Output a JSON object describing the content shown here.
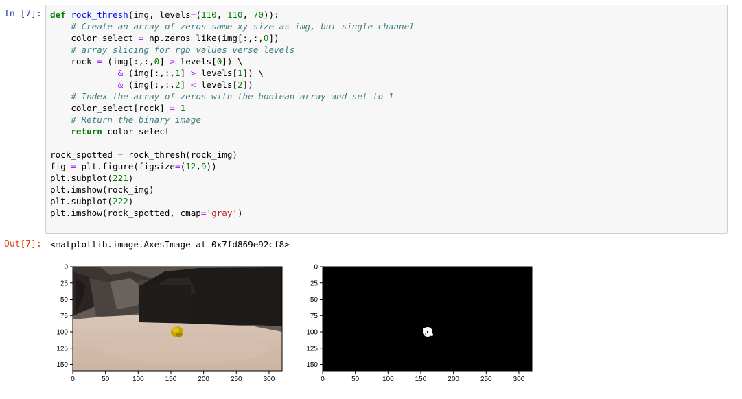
{
  "cell": {
    "in_prompt": "In [7]:",
    "out_prompt": "Out[7]:",
    "output_text": "<matplotlib.image.AxesImage at 0x7fd869e92cf8>"
  },
  "code_lines": [
    [
      [
        "kw",
        "def"
      ],
      [
        "t",
        " "
      ],
      [
        "fn",
        "rock_thresh"
      ],
      [
        "t",
        "(img, levels"
      ],
      [
        "op",
        "="
      ],
      [
        "t",
        "("
      ],
      [
        "num",
        "110"
      ],
      [
        "t",
        ", "
      ],
      [
        "num",
        "110"
      ],
      [
        "t",
        ", "
      ],
      [
        "num",
        "70"
      ],
      [
        "t",
        "))"
      ],
      [
        "t",
        ":"
      ]
    ],
    [
      [
        "t",
        "    "
      ],
      [
        "cm",
        "# Create an array of zeros same xy size as img, but single channel"
      ]
    ],
    [
      [
        "t",
        "    color_select "
      ],
      [
        "op",
        "="
      ],
      [
        "t",
        " np.zeros_like(img[:,:,"
      ],
      [
        "num",
        "0"
      ],
      [
        "t",
        "])"
      ]
    ],
    [
      [
        "t",
        "    "
      ],
      [
        "cm",
        "# array slicing for rgb values verse levels"
      ]
    ],
    [
      [
        "t",
        "    rock "
      ],
      [
        "op",
        "="
      ],
      [
        "t",
        " (img[:,:,"
      ],
      [
        "num",
        "0"
      ],
      [
        "t",
        "] "
      ],
      [
        "op",
        ">"
      ],
      [
        "t",
        " levels["
      ],
      [
        "num",
        "0"
      ],
      [
        "t",
        "]) \\"
      ]
    ],
    [
      [
        "t",
        "             "
      ],
      [
        "op",
        "&"
      ],
      [
        "t",
        " (img[:,:,"
      ],
      [
        "num",
        "1"
      ],
      [
        "t",
        "] "
      ],
      [
        "op",
        ">"
      ],
      [
        "t",
        " levels["
      ],
      [
        "num",
        "1"
      ],
      [
        "t",
        "]) \\"
      ]
    ],
    [
      [
        "t",
        "             "
      ],
      [
        "op",
        "&"
      ],
      [
        "t",
        " (img[:,:,"
      ],
      [
        "num",
        "2"
      ],
      [
        "t",
        "] "
      ],
      [
        "op",
        "<"
      ],
      [
        "t",
        " levels["
      ],
      [
        "num",
        "2"
      ],
      [
        "t",
        "])"
      ]
    ],
    [
      [
        "t",
        "    "
      ],
      [
        "cm",
        "# Index the array of zeros with the boolean array and set to 1"
      ]
    ],
    [
      [
        "t",
        "    color_select[rock] "
      ],
      [
        "op",
        "="
      ],
      [
        "t",
        " "
      ],
      [
        "num",
        "1"
      ]
    ],
    [
      [
        "t",
        "    "
      ],
      [
        "cm",
        "# Return the binary image"
      ]
    ],
    [
      [
        "t",
        "    "
      ],
      [
        "kw",
        "return"
      ],
      [
        "t",
        " color_select"
      ]
    ],
    [
      [
        "t",
        ""
      ]
    ],
    [
      [
        "t",
        "rock_spotted "
      ],
      [
        "op",
        "="
      ],
      [
        "t",
        " rock_thresh(rock_img)"
      ]
    ],
    [
      [
        "t",
        "fig "
      ],
      [
        "op",
        "="
      ],
      [
        "t",
        " plt.figure(figsize"
      ],
      [
        "op",
        "="
      ],
      [
        "t",
        "("
      ],
      [
        "num",
        "12"
      ],
      [
        "t",
        ","
      ],
      [
        "num",
        "9"
      ],
      [
        "t",
        "))"
      ]
    ],
    [
      [
        "t",
        "plt.subplot("
      ],
      [
        "num",
        "221"
      ],
      [
        "t",
        ")"
      ]
    ],
    [
      [
        "t",
        "plt.imshow(rock_img)"
      ]
    ],
    [
      [
        "t",
        "plt.subplot("
      ],
      [
        "num",
        "222"
      ],
      [
        "t",
        ")"
      ]
    ],
    [
      [
        "t",
        "plt.imshow(rock_spotted, cmap"
      ],
      [
        "op",
        "="
      ],
      [
        "st",
        "'gray'"
      ],
      [
        "t",
        ")"
      ]
    ]
  ],
  "plots": {
    "x_ticks": [
      "0",
      "50",
      "100",
      "150",
      "200",
      "250",
      "300"
    ],
    "y_ticks": [
      "0",
      "25",
      "50",
      "75",
      "100",
      "125",
      "150"
    ],
    "left_image": "rover camera view with yellow rock",
    "right_image": "binary threshold result"
  },
  "colors": {
    "keyword": "#008000",
    "function": "#0000ff",
    "comment": "#408080",
    "operator": "#aa22ff",
    "string": "#ba2121",
    "in_prompt": "#303f9f",
    "out_prompt": "#d84315"
  }
}
